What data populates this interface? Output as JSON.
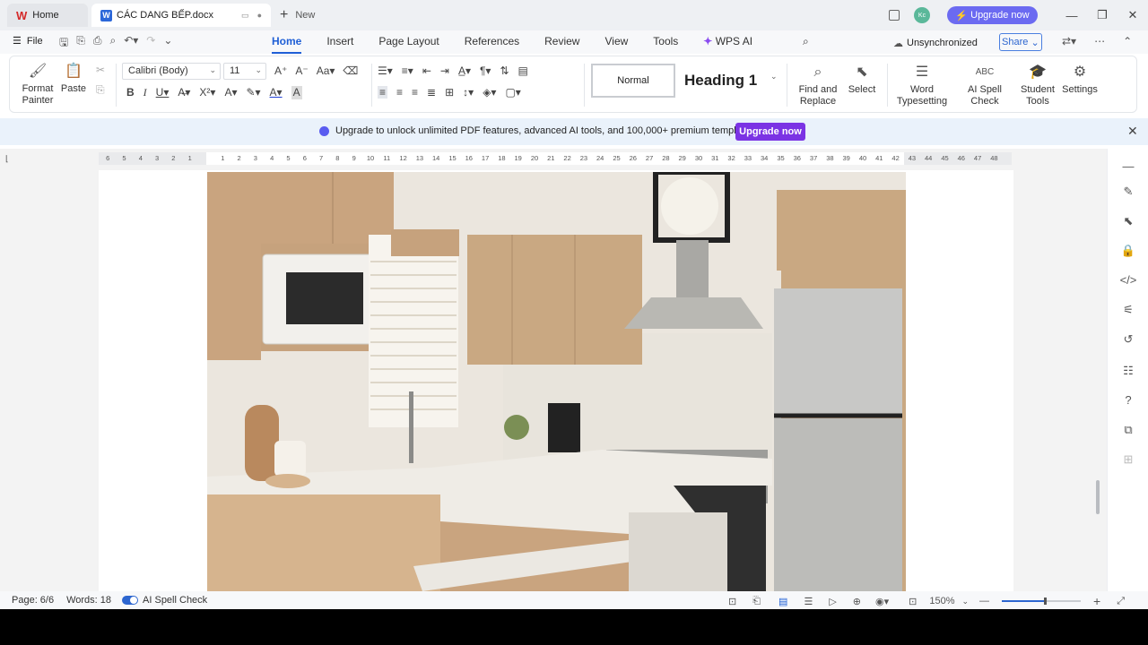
{
  "tabs": {
    "home": "Home",
    "doc": "CÁC DANG BẾP.docx",
    "new": "New"
  },
  "titlebar": {
    "avatar_initials": "Kc",
    "upgrade": "Upgrade now"
  },
  "menu": {
    "file": "File",
    "items": [
      "Home",
      "Insert",
      "Page Layout",
      "References",
      "Review",
      "View",
      "Tools"
    ],
    "wps_ai": "WPS AI",
    "sync_status": "Unsynchronized",
    "share": "Share"
  },
  "ribbon": {
    "format_painter": "Format Painter",
    "paste": "Paste",
    "font_name": "Calibri (Body)",
    "font_size": "11",
    "style_normal": "Normal",
    "style_heading1": "Heading 1",
    "find_replace": "Find and Replace",
    "select": "Select",
    "word_typesetting": "Word Typesetting",
    "ai_spell_check": "AI Spell Check",
    "student_tools": "Student Tools",
    "settings": "Settings"
  },
  "banner": {
    "text": "Upgrade to unlock unlimited PDF features, advanced AI tools, and 100,000+ premium templates.",
    "button": "Upgrade now"
  },
  "ruler": {
    "left_ticks": [
      "6",
      "5",
      "4",
      "3",
      "2",
      "1"
    ],
    "right_ticks": [
      "1",
      "2",
      "3",
      "4",
      "5",
      "6",
      "7",
      "8",
      "9",
      "10",
      "11",
      "12",
      "13",
      "14",
      "15",
      "16",
      "17",
      "18",
      "19",
      "20",
      "21",
      "22",
      "23",
      "24",
      "25",
      "26",
      "27",
      "28",
      "29",
      "30",
      "31",
      "32",
      "33",
      "34",
      "35",
      "36",
      "37",
      "38",
      "39",
      "40",
      "41",
      "42",
      "43",
      "44",
      "45",
      "46",
      "47",
      "48"
    ]
  },
  "status": {
    "page": "Page: 6/6",
    "words": "Words: 18",
    "spell_check": "AI Spell Check",
    "zoom": "150%",
    "zoom_fraction": 0.55
  },
  "colors": {
    "accent": "#1f5fd6",
    "upgrade_pill": "#6b6af1",
    "banner_button": "#7b33e4",
    "banner_bg": "#eaf2fb"
  }
}
